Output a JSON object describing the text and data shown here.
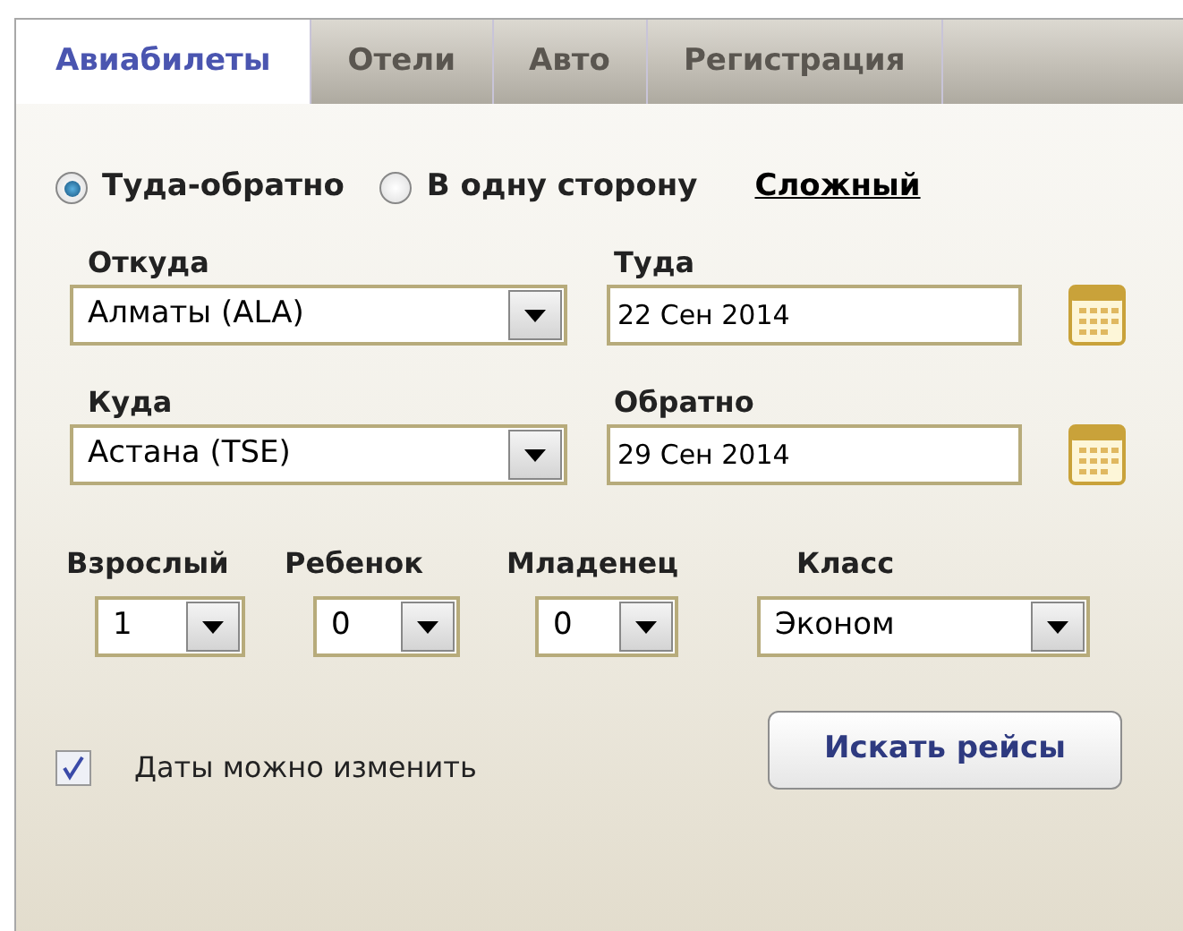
{
  "tabs": [
    {
      "label": "Авиабилеты",
      "selected": true
    },
    {
      "label": "Отели",
      "selected": false
    },
    {
      "label": "Авто",
      "selected": false
    },
    {
      "label": "Регистрация",
      "selected": false
    }
  ],
  "trip_type": [
    {
      "label": "Туда-обратно",
      "selected": true
    },
    {
      "label": "В одну сторону",
      "selected": false
    }
  ],
  "complex_link": "Сложный",
  "routes": [
    {
      "city_label": "Откуда",
      "city": "Алматы (ALA)",
      "date_label": "Туда",
      "date": "22 Сен 2014"
    },
    {
      "city_label": "Куда",
      "city": "Астана (TSE)",
      "date_label": "Обратно",
      "date": "29 Сен 2014"
    }
  ],
  "passengers": [
    {
      "label": "Взрослый",
      "value": "1"
    },
    {
      "label": "Ребенок",
      "value": "0"
    },
    {
      "label": "Младенец",
      "value": "0"
    }
  ],
  "class": {
    "label": "Класс",
    "value": "Эконом"
  },
  "flexible_dates": {
    "label": "Даты можно изменить",
    "checked": true
  },
  "search_button": "Искать рейсы"
}
